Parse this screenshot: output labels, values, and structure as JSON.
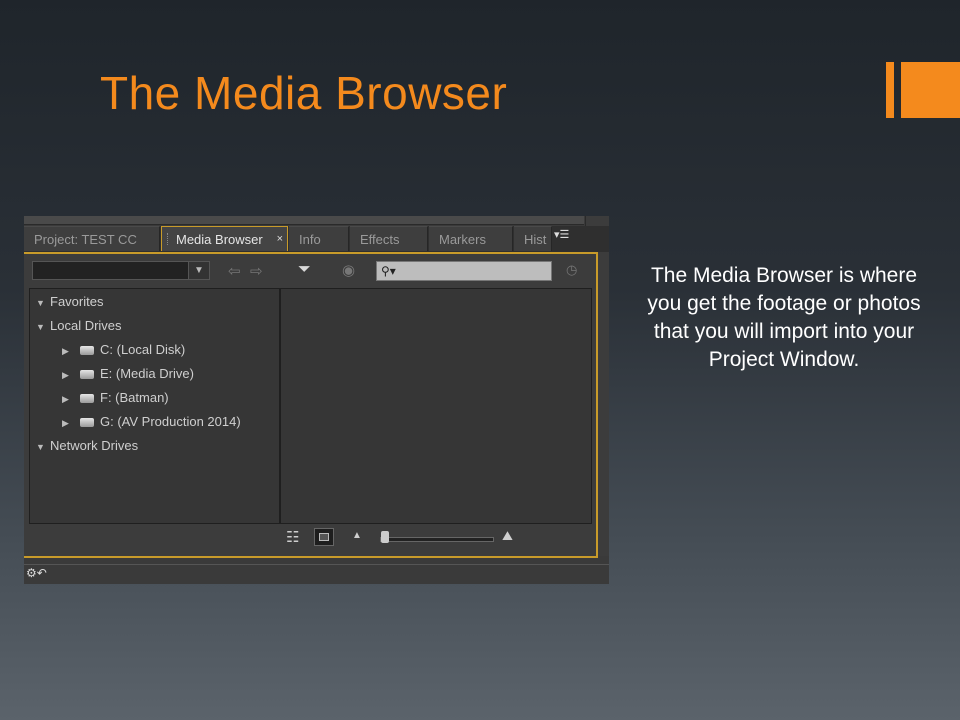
{
  "slide": {
    "title": "The Media Browser",
    "description": "The Media Browser is where you get the footage or photos that you will import into your Project Window."
  },
  "panel": {
    "tabs": [
      {
        "label": "Project: TEST CC",
        "active": false
      },
      {
        "label": "Media Browser",
        "active": true
      },
      {
        "label": "Info",
        "active": false
      },
      {
        "label": "Effects",
        "active": false
      },
      {
        "label": "Markers",
        "active": false
      },
      {
        "label": "Hist",
        "active": false
      }
    ],
    "close_glyph": "×",
    "search_placeholder": "",
    "tree": [
      {
        "label": "Favorites",
        "level": 0,
        "type": "folder",
        "expanded": true
      },
      {
        "label": "Local Drives",
        "level": 0,
        "type": "folder",
        "expanded": true
      },
      {
        "label": "C: (Local Disk)",
        "level": 1,
        "type": "drive",
        "expanded": false
      },
      {
        "label": "E: (Media Drive)",
        "level": 1,
        "type": "drive",
        "expanded": false
      },
      {
        "label": "F: (Batman)",
        "level": 1,
        "type": "drive",
        "expanded": false
      },
      {
        "label": "G: (AV Production 2014)",
        "level": 1,
        "type": "drive",
        "expanded": false
      },
      {
        "label": "Network Drives",
        "level": 0,
        "type": "folder",
        "expanded": true
      }
    ],
    "icons": {
      "back": "back-arrow-icon",
      "forward": "forward-arrow-icon",
      "filter": "filter-icon",
      "view": "eye-icon",
      "search": "search-icon",
      "list_view": "list-view-icon",
      "icon_view": "icon-view-icon",
      "zoom_out": "zoom-small-icon",
      "zoom_in": "zoom-large-icon",
      "settings": "gear-icon"
    },
    "zoom_level": 0.05
  },
  "colors": {
    "accent": "#f48a1d",
    "panel_focus_border": "#c89b2a"
  }
}
